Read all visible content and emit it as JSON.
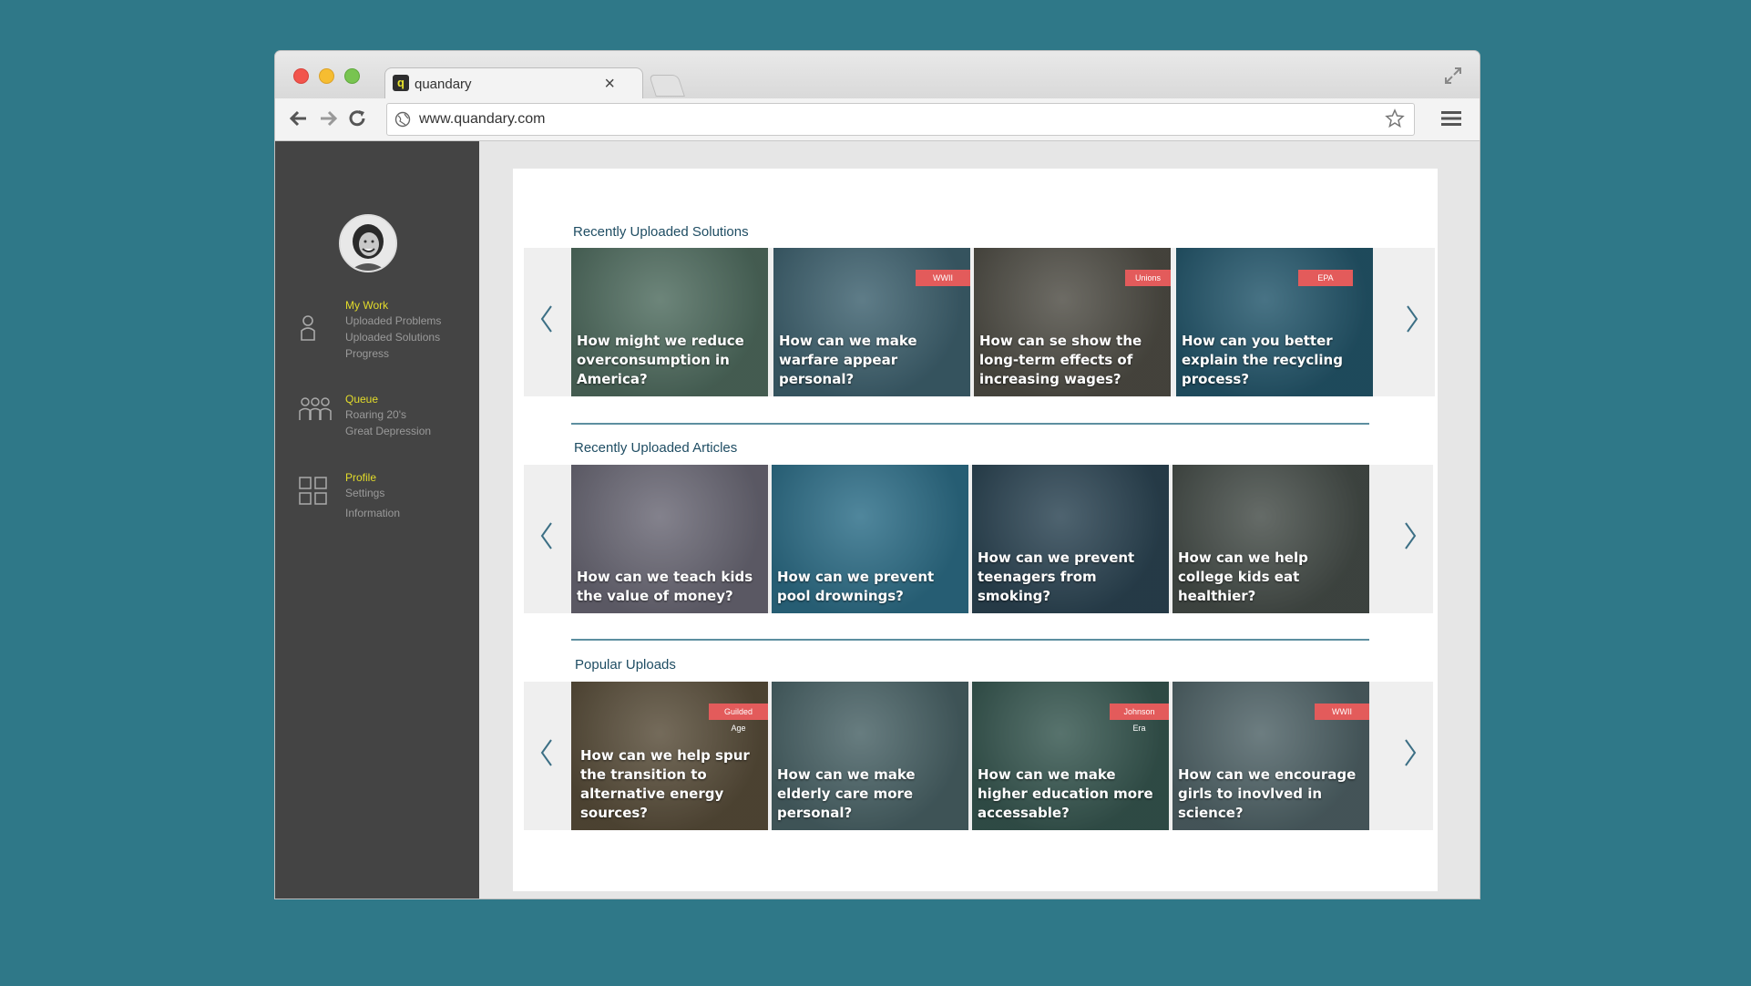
{
  "browser": {
    "tab_title": "quandary",
    "tab_favicon": "q",
    "tab_close": "×",
    "url": "www.quandary.com"
  },
  "sidebar": {
    "groups": [
      {
        "heading": "My Work",
        "items": [
          "Uploaded Problems",
          "Uploaded Solutions",
          "Progress"
        ],
        "icon": "person-icon"
      },
      {
        "heading": "Queue",
        "items": [
          "Roaring 20's",
          "Great Depression"
        ],
        "icon": "group-icon"
      },
      {
        "heading": "Profile",
        "items": [
          "Settings",
          "Information"
        ],
        "icon": "grid-icon"
      }
    ]
  },
  "sections": [
    {
      "title": "Recently Uploaded Solutions",
      "cards": [
        {
          "text": "How might we reduce overconsumption in America?",
          "tag": "",
          "bg": "#7a8f6a"
        },
        {
          "text": "How can we make warfare appear personal?",
          "tag": "WWII",
          "bg": "#5d7d86"
        },
        {
          "text": "How can se show the long-term effects of increasing wages?",
          "tag": "Unions",
          "bg": "#7a5a3e"
        },
        {
          "text": "How can you better explain the recycling process?",
          "tag": "EPA",
          "bg": "#2f6a80"
        }
      ]
    },
    {
      "title": "Recently Uploaded Articles",
      "cards": [
        {
          "text": "How can we teach kids the value of money?",
          "tag": "",
          "bg": "#a88890"
        },
        {
          "text": "How can we prevent pool drownings?",
          "tag": "",
          "bg": "#3f92b0"
        },
        {
          "text": "How can we prevent teenagers from smoking?",
          "tag": "",
          "bg": "#3c4a55"
        },
        {
          "text": "How can we help college kids eat healthier?",
          "tag": "",
          "bg": "#6a5a44"
        }
      ]
    },
    {
      "title": "Popular Uploads",
      "cards": [
        {
          "text": "How can we help spur the transition to alternative energy sources?",
          "tag": "Guilded Age",
          "bg": "#8a5a2a"
        },
        {
          "text": "How can we make elderly care more personal?",
          "tag": "",
          "bg": "#6f7e76"
        },
        {
          "text": "How can we make higher education more accessable?",
          "tag": "Johnson Era",
          "bg": "#4f6a50"
        },
        {
          "text": "How can we encourage girls to inovlved in science?",
          "tag": "WWII",
          "bg": "#7a7f78"
        }
      ]
    }
  ],
  "colors": {
    "background": "#2f7888",
    "sidebar": "#444444",
    "accent_yellow": "#e3dc2a",
    "tag_red": "#e35b5b",
    "section_title": "#1f4d63"
  }
}
